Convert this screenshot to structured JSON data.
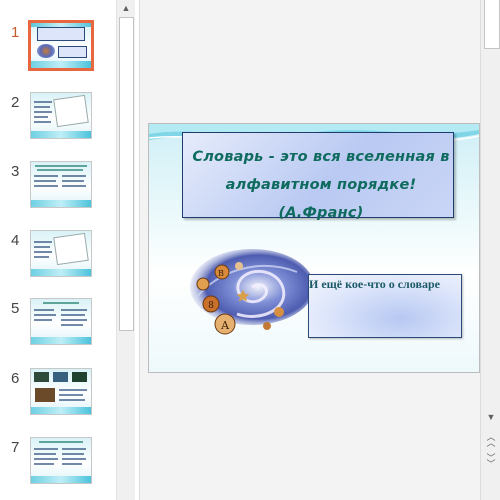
{
  "thumbnails": [
    {
      "number": "1",
      "selected": true
    },
    {
      "number": "2",
      "selected": false
    },
    {
      "number": "3",
      "selected": false
    },
    {
      "number": "4",
      "selected": false
    },
    {
      "number": "5",
      "selected": false
    },
    {
      "number": "6",
      "selected": false
    },
    {
      "number": "7",
      "selected": false
    }
  ],
  "slide": {
    "title": "Словарь - это вся вселенная в алфавитном порядке! (А.Франс)",
    "subtitle": "И ещё кое-что о словаре"
  },
  "icons": {
    "scroll_up": "scroll-up-arrow-icon",
    "scroll_down": "scroll-down-arrow-icon",
    "previous_slide": "double-chevron-up-icon",
    "next_slide": "double-chevron-down-icon"
  },
  "colors": {
    "selected_border": "#e8673e",
    "title_text": "#0f6b5e",
    "box_border": "#1f3c6e"
  }
}
